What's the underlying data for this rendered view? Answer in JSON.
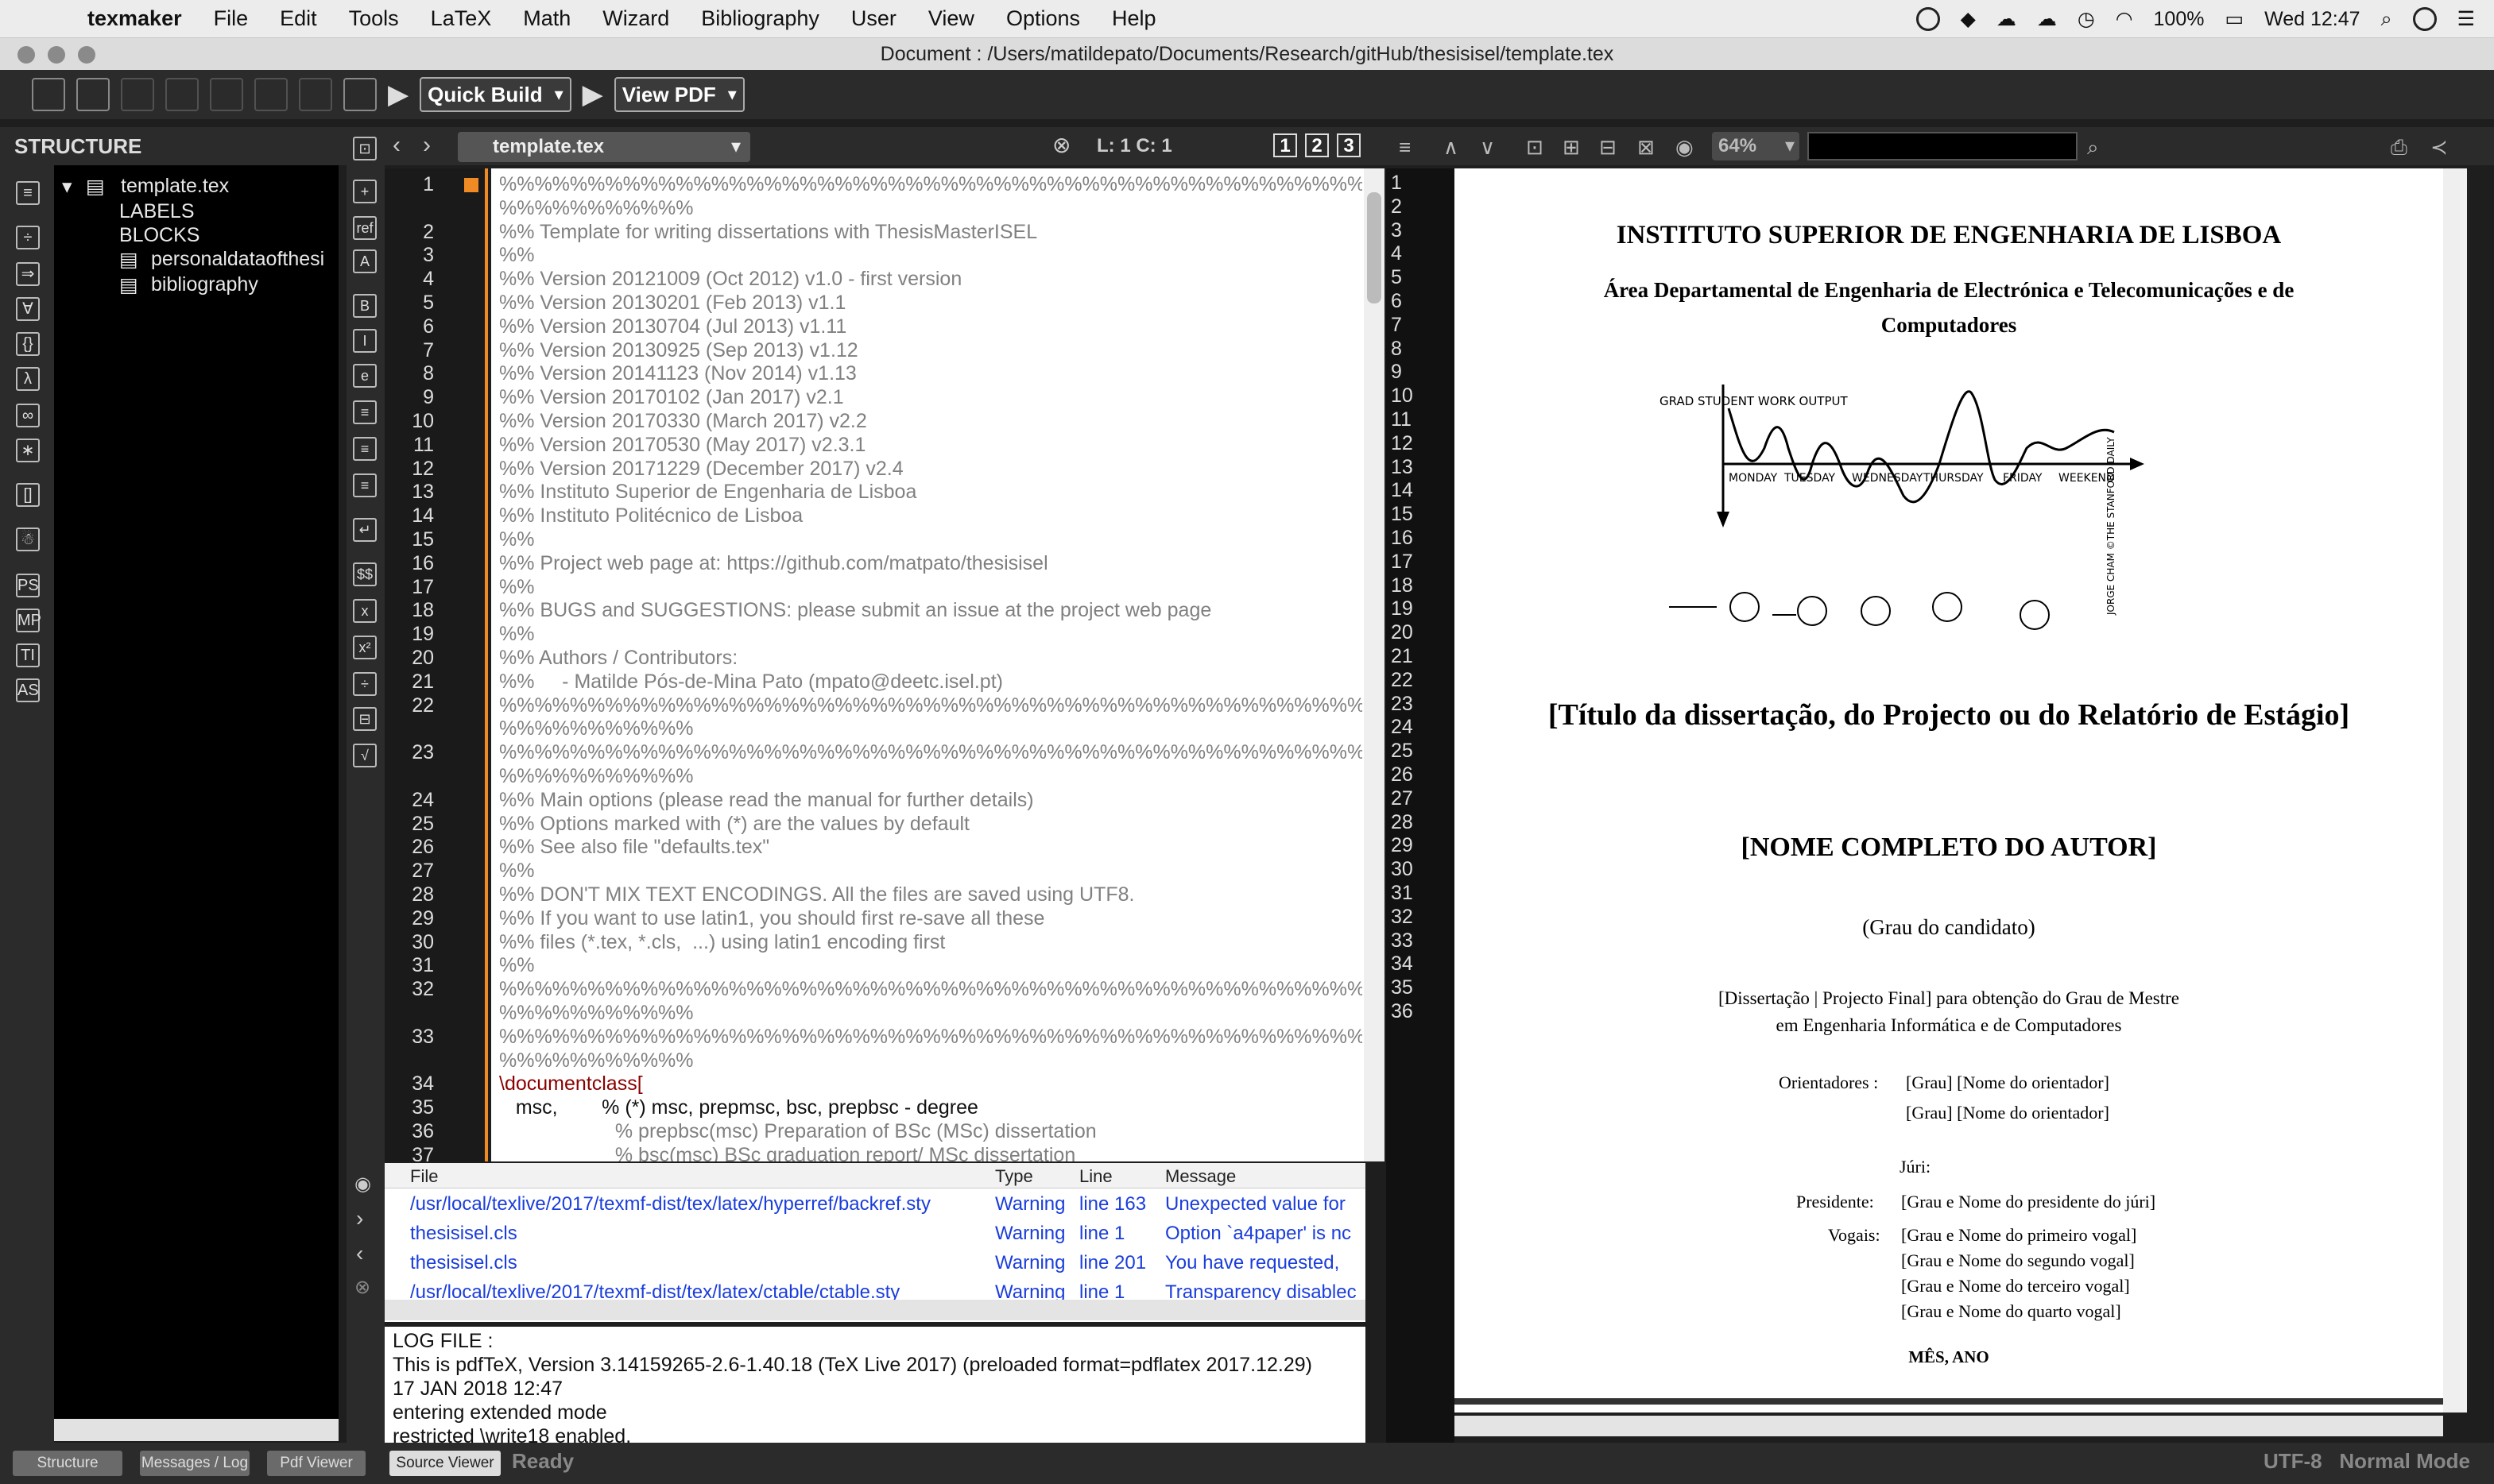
{
  "menubar": {
    "app_name": "texmaker",
    "items": [
      "File",
      "Edit",
      "Tools",
      "LaTeX",
      "Math",
      "Wizard",
      "Bibliography",
      "User",
      "View",
      "Options",
      "Help"
    ],
    "battery": "100%",
    "clock": "Wed 12:47"
  },
  "window": {
    "title": "Document : /Users/matildepato/Documents/Research/gitHub/thesisisel/template.tex"
  },
  "toolbar": {
    "quick_build": "Quick Build",
    "view_pdf": "View PDF"
  },
  "structure": {
    "title": "STRUCTURE",
    "root": "template.tex",
    "labels": "LABELS",
    "blocks": "BLOCKS",
    "children": [
      "personaldataofthesi",
      "bibliography"
    ]
  },
  "editor": {
    "current_file": "template.tex",
    "cursor": "L: 1 C: 1",
    "view_buttons": [
      "1",
      "2",
      "3"
    ],
    "lines": [
      {
        "n": "1",
        "text": "%%%%%%%%%%%%%%%%%%%%%%%%%%%%%%%%%%%%%%%%%%%%%%%%%%%%%%%%%%%%%%%%%%%%%"
      },
      {
        "n": "",
        "text": "%%%%%%%%%%%"
      },
      {
        "n": "2",
        "text": "%% Template for writing dissertations with ThesisMasterISEL"
      },
      {
        "n": "3",
        "text": "%%"
      },
      {
        "n": "4",
        "text": "%% Version 20121009 (Oct 2012) v1.0 - first version"
      },
      {
        "n": "5",
        "text": "%% Version 20130201 (Feb 2013) v1.1"
      },
      {
        "n": "6",
        "text": "%% Version 20130704 (Jul 2013) v1.11"
      },
      {
        "n": "7",
        "text": "%% Version 20130925 (Sep 2013) v1.12"
      },
      {
        "n": "8",
        "text": "%% Version 20141123 (Nov 2014) v1.13"
      },
      {
        "n": "9",
        "text": "%% Version 20170102 (Jan 2017) v2.1"
      },
      {
        "n": "10",
        "text": "%% Version 20170330 (March 2017) v2.2"
      },
      {
        "n": "11",
        "text": "%% Version 20170530 (May 2017) v2.3.1"
      },
      {
        "n": "12",
        "text": "%% Version 20171229 (December 2017) v2.4"
      },
      {
        "n": "13",
        "text": "%% Instituto Superior de Engenharia de Lisboa"
      },
      {
        "n": "14",
        "text": "%% Instituto Politécnico de Lisboa"
      },
      {
        "n": "15",
        "text": "%%"
      },
      {
        "n": "16",
        "text": "%% Project web page at: https://github.com/matpato/thesisisel"
      },
      {
        "n": "17",
        "text": "%%"
      },
      {
        "n": "18",
        "text": "%% BUGS and SUGGESTIONS: please submit an issue at the project web page"
      },
      {
        "n": "19",
        "text": "%%"
      },
      {
        "n": "20",
        "text": "%% Authors / Contributors:"
      },
      {
        "n": "21",
        "text": "%%     - Matilde Pós-de-Mina Pato (mpato@deetc.isel.pt)"
      },
      {
        "n": "22",
        "text": "%%%%%%%%%%%%%%%%%%%%%%%%%%%%%%%%%%%%%%%%%%%%%%%%%%%%%%%%%%%%%%%%%%%%%"
      },
      {
        "n": "",
        "text": "%%%%%%%%%%%"
      },
      {
        "n": "23",
        "text": "%%%%%%%%%%%%%%%%%%%%%%%%%%%%%%%%%%%%%%%%%%%%%%%%%%%%%%%%%%%%%%%%%%%%%"
      },
      {
        "n": "",
        "text": "%%%%%%%%%%%"
      },
      {
        "n": "24",
        "text": "%% Main options (please read the manual for further details)"
      },
      {
        "n": "25",
        "text": "%% Options marked with (*) are the values by default"
      },
      {
        "n": "26",
        "text": "%% See also file \"defaults.tex\""
      },
      {
        "n": "27",
        "text": "%%"
      },
      {
        "n": "28",
        "text": "%% DON'T MIX TEXT ENCODINGS. All the files are saved using UTF8."
      },
      {
        "n": "29",
        "text": "%% If you want to use latin1, you should first re-save all these"
      },
      {
        "n": "30",
        "text": "%% files (*.tex, *.cls,  ...) using latin1 encoding first"
      },
      {
        "n": "31",
        "text": "%%"
      },
      {
        "n": "32",
        "text": "%%%%%%%%%%%%%%%%%%%%%%%%%%%%%%%%%%%%%%%%%%%%%%%%%%%%%%%%%%%%%%%%%%%%%"
      },
      {
        "n": "",
        "text": "%%%%%%%%%%%"
      },
      {
        "n": "33",
        "text": "%%%%%%%%%%%%%%%%%%%%%%%%%%%%%%%%%%%%%%%%%%%%%%%%%%%%%%%%%%%%%%%%%%%%%"
      },
      {
        "n": "",
        "text": "%%%%%%%%%%%"
      },
      {
        "n": "34",
        "text": "\\documentclass["
      },
      {
        "n": "35",
        "text": "   msc,        % (*) msc, prepmsc, bsc, prepbsc - degree"
      },
      {
        "n": "36",
        "text": "                     % prepbsc(msc) Preparation of BSc (MSc) dissertation"
      },
      {
        "n": "37",
        "text": "                     % bsc(msc) BSc graduation report/ MSc dissertation"
      }
    ]
  },
  "messages": {
    "headers": [
      "File",
      "Type",
      "Line",
      "Message"
    ],
    "rows": [
      {
        "file": "/usr/local/texlive/2017/texmf-dist/tex/latex/hyperref/backref.sty",
        "type": "Warning",
        "line": "line 163",
        "message": "Unexpected value for"
      },
      {
        "file": "thesisisel.cls",
        "type": "Warning",
        "line": "line 1",
        "message": "Option `a4paper' is nc"
      },
      {
        "file": "thesisisel.cls",
        "type": "Warning",
        "line": "line 201",
        "message": "You have requested,"
      },
      {
        "file": "/usr/local/texlive/2017/texmf-dist/tex/latex/ctable/ctable.sty",
        "type": "Warning",
        "line": "line 1",
        "message": "Transparency disablec"
      }
    ]
  },
  "log": {
    "lines": [
      "LOG FILE :",
      "This is pdfTeX, Version 3.14159265-2.6-1.40.18 (TeX Live 2017) (preloaded format=pdflatex 2017.12.29)",
      "17 JAN 2018 12:47",
      "entering extended mode",
      "restricted \\write18 enabled."
    ]
  },
  "pdf": {
    "zoom": "64%",
    "page_numbers": [
      "1",
      "2",
      "3",
      "4",
      "5",
      "6",
      "7",
      "8",
      "9",
      "10",
      "11",
      "12",
      "13",
      "14",
      "15",
      "16",
      "17",
      "18",
      "19",
      "20",
      "21",
      "22",
      "23",
      "24",
      "25",
      "26",
      "27",
      "28",
      "29",
      "30",
      "31",
      "32",
      "33",
      "34",
      "35",
      "36"
    ],
    "institution": "INSTITUTO SUPERIOR DE ENGENHARIA DE LISBOA",
    "department_line1": "Área Departamental de Engenharia de Electrónica e Telecomunicações e de",
    "department_line2": "Computadores",
    "comic": {
      "ylabel": "GRAD STUDENT WORK OUTPUT",
      "days": [
        "MONDAY",
        "TUESDAY",
        "WEDNESDAY",
        "THURSDAY",
        "FRIDAY",
        "WEEKEND"
      ],
      "credit": "JORGE CHAM ©THE STANFORD DAILY"
    },
    "title": "[Título da dissertação, do Projecto ou do Relatório de Estágio]",
    "author": "[NOME COMPLETO DO AUTOR]",
    "degree": "(Grau do candidato)",
    "purpose_line1": "[Dissertação | Projecto Final]  para obtenção do Grau de Mestre",
    "purpose_line2": "em Engenharia Informática e de Computadores",
    "advisors_label": "Orientadores :",
    "advisors": [
      "[Grau] [Nome do orientador]",
      "[Grau] [Nome do orientador]"
    ],
    "jury_label": "Júri:",
    "president_label": "Presidente:",
    "president": "[Grau e Nome do presidente do júri]",
    "members_label": "Vogais:",
    "members": [
      "[Grau e Nome do primeiro vogal]",
      "[Grau e Nome do segundo vogal]",
      "[Grau e Nome do terceiro vogal]",
      "[Grau e Nome do quarto vogal]"
    ],
    "date": "MÊS, ANO"
  },
  "statusbar": {
    "tabs": [
      "Structure",
      "Messages / Log",
      "Pdf Viewer",
      "Source Viewer"
    ],
    "state": "Ready",
    "encoding": "UTF-8",
    "mode": "Normal Mode"
  }
}
